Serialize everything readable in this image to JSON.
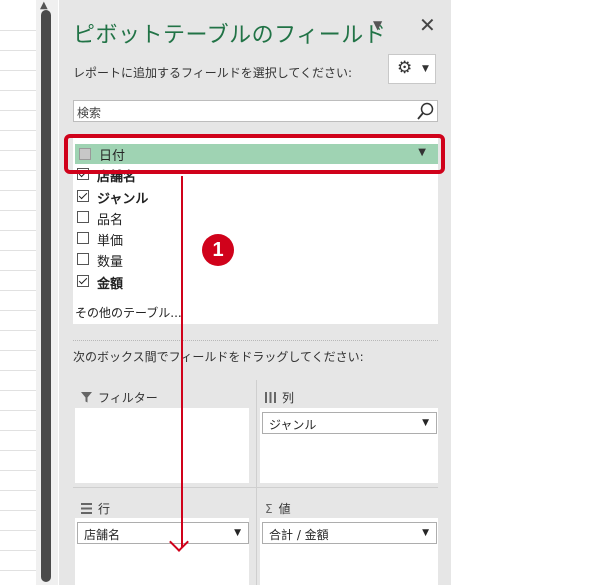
{
  "pane": {
    "title": "ピボットテーブルのフィールド",
    "choose_label": "レポートに追加するフィールドを選択してください:",
    "search_placeholder": "検索",
    "more_tables": "その他のテーブル...",
    "drag_label": "次のボックス間でフィールドをドラッグしてください:",
    "gear_icon": "gear-icon",
    "close_glyph": "✕"
  },
  "fields": [
    {
      "label": "日付",
      "checked": false,
      "highlighted": true
    },
    {
      "label": "店舗名",
      "checked": true
    },
    {
      "label": "ジャンル",
      "checked": true
    },
    {
      "label": "品名",
      "checked": false
    },
    {
      "label": "単価",
      "checked": false
    },
    {
      "label": "数量",
      "checked": false
    },
    {
      "label": "金額",
      "checked": true
    }
  ],
  "areas": {
    "filter": {
      "label": "フィルター",
      "icon": "filter-icon"
    },
    "columns": {
      "label": "列",
      "icon": "columns-icon",
      "chip": "ジャンル"
    },
    "rows": {
      "label": "行",
      "icon": "rows-icon",
      "chip": "店舗名"
    },
    "values": {
      "label": "値",
      "icon": "sigma-icon",
      "chip": "合計 / 金額"
    }
  },
  "annotation": {
    "step_number": "1",
    "color": "#d0021b"
  },
  "colors": {
    "accent": "#217346",
    "highlight_row": "#9fd3b3"
  }
}
